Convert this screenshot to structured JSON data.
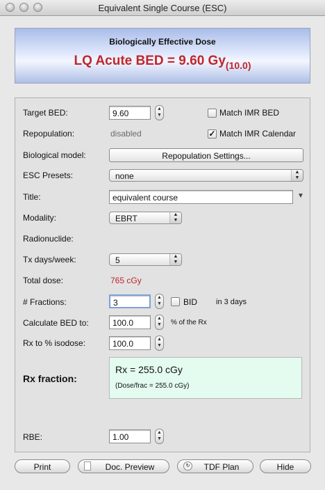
{
  "window": {
    "title": "Equivalent Single Course (ESC)"
  },
  "header": {
    "subtitle": "Biologically Effective Dose",
    "main_text": "LQ Acute BED = 9.60 Gy",
    "main_sub": "(10.0)"
  },
  "form": {
    "target_bed": {
      "label": "Target BED:",
      "value": "9.60"
    },
    "match_imr_bed": {
      "label": "Match IMR BED",
      "checked": false
    },
    "repopulation": {
      "label": "Repopulation:",
      "value": "disabled"
    },
    "match_imr_calendar": {
      "label": "Match IMR Calendar",
      "checked": true
    },
    "bio_model": {
      "label": "Biological model:",
      "button": "Repopulation Settings..."
    },
    "esc_presets": {
      "label": "ESC Presets:",
      "value": "none"
    },
    "title": {
      "label": "Title:",
      "value": "equivalent course"
    },
    "modality": {
      "label": "Modality:",
      "value": "EBRT"
    },
    "radionuclide": {
      "label": "Radionuclide:"
    },
    "tx_days": {
      "label": "Tx days/week:",
      "value": "5"
    },
    "total_dose": {
      "label": "Total dose:",
      "value": "765 cGy"
    },
    "fractions": {
      "label": "# Fractions:",
      "value": "3",
      "bid_label": "BID",
      "bid_checked": false,
      "days_text": "in 3 days"
    },
    "calc_bed": {
      "label": "Calculate BED to:",
      "value": "100.0",
      "suffix": "% of the Rx"
    },
    "rx_isodose": {
      "label": "Rx to % isodose:",
      "value": "100.0"
    },
    "rx_fraction": {
      "label": "Rx fraction:",
      "value": "Rx = 255.0 cGy",
      "detail": "(Dose/frac = 255.0 cGy)"
    },
    "rbe": {
      "label": "RBE:",
      "value": "1.00"
    }
  },
  "buttons": {
    "print": "Print",
    "doc_preview": "Doc. Preview",
    "tdf_plan": "TDF Plan",
    "hide": "Hide"
  },
  "colors": {
    "accent_red": "#c0262c",
    "rx_box_bg": "#e4fbf0",
    "header_blue": "#a9bde9"
  }
}
